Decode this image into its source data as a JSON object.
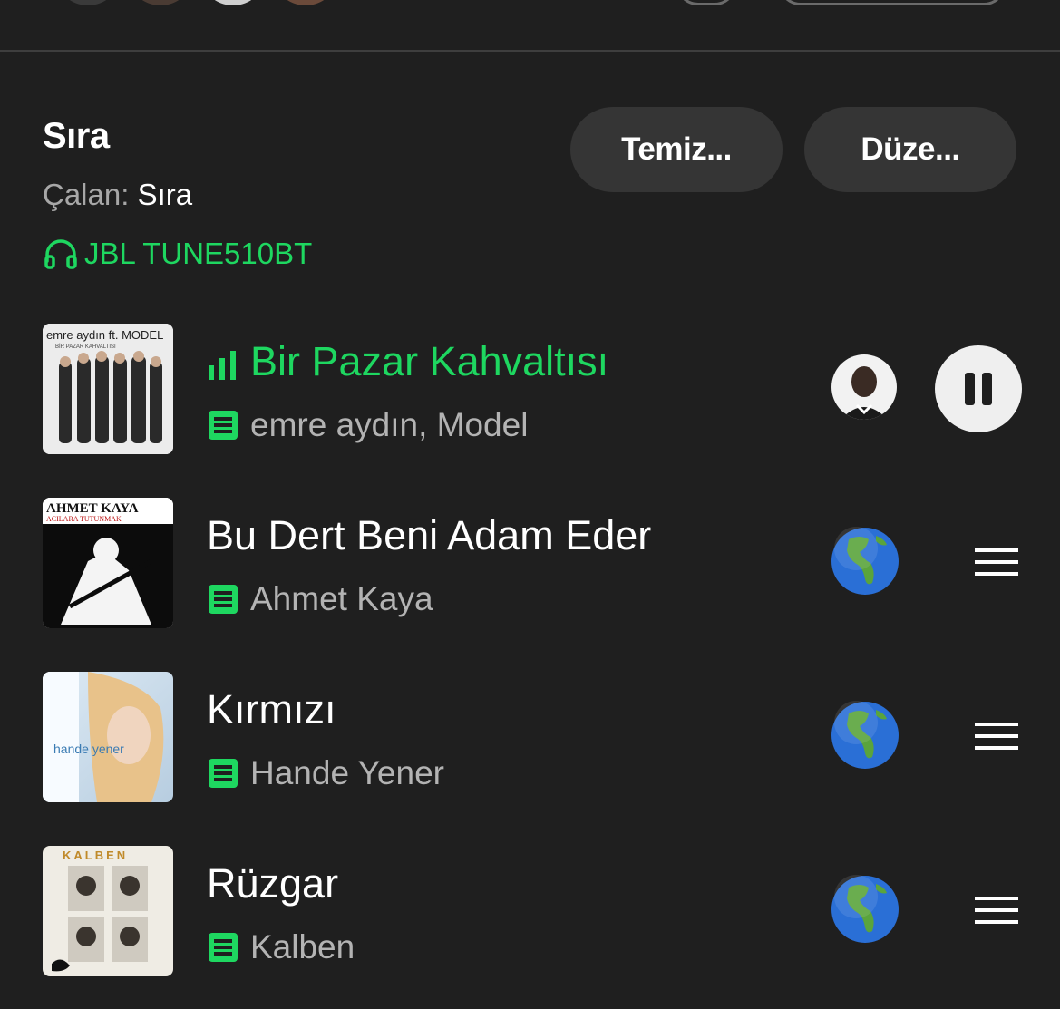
{
  "queue": {
    "title": "Sıra",
    "now_playing_label": "Çalan:",
    "now_playing_value": "Sıra",
    "device_icon": "headphones-icon",
    "device_name": "JBL TUNE510BT",
    "clear_button": "Temiz...",
    "edit_button": "Düze..."
  },
  "colors": {
    "accent": "#1ed760",
    "background": "#1f1f1f",
    "pill": "#353535",
    "secondary_text": "#b3b3b3"
  },
  "tracks": [
    {
      "title": "Bir Pazar Kahvaltısı",
      "artist": "emre aydın, Model",
      "playing": true,
      "cover_text": "emre aydın ft. MODEL",
      "cover_subtext": "BİR PAZAR KAHVALTISI",
      "right_icon": "pause-icon"
    },
    {
      "title": "Bu Dert Beni Adam Eder",
      "artist": "Ahmet Kaya",
      "playing": false,
      "cover_text": "AHMET KAYA",
      "cover_subtext": "ACILARA TUTUNMAK",
      "right_icon": "drag-handle-icon"
    },
    {
      "title": "Kırmızı",
      "artist": "Hande Yener",
      "playing": false,
      "cover_text": "hande yener",
      "cover_subtext": "",
      "right_icon": "drag-handle-icon"
    },
    {
      "title": "Rüzgar",
      "artist": "Kalben",
      "playing": false,
      "cover_text": "KALBEN",
      "cover_subtext": "",
      "right_icon": "drag-handle-icon"
    }
  ]
}
